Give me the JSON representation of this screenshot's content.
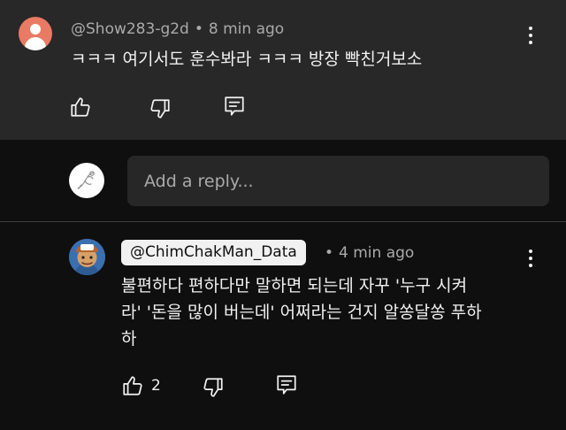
{
  "comment": {
    "author": "@Show283-g2d",
    "separator": "•",
    "time": "8 min ago",
    "text": "ㅋㅋㅋ 여기서도 훈수봐라 ㅋㅋㅋ 방장 빡친거보소",
    "avatar_color": "#e97a63"
  },
  "reply_box": {
    "placeholder": "Add a reply..."
  },
  "reply": {
    "author": "@ChimChakMan_Data",
    "separator": "•",
    "time": "4 min ago",
    "text_lines": [
      "불편하다 편하다만 말하면 되는데 자꾸 '누구 시켜",
      "라' '돈을 많이 버는데' 어쩌라는 건지 알쏭달쏭 푸하",
      "하"
    ],
    "like_count": "2"
  },
  "icons": [
    "like-icon",
    "dislike-icon",
    "reply-icon",
    "more-vert-icon"
  ]
}
